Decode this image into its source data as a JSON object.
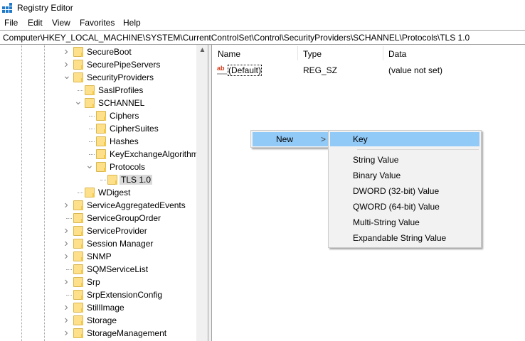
{
  "window": {
    "title": "Registry Editor"
  },
  "menubar": [
    "File",
    "Edit",
    "View",
    "Favorites",
    "Help"
  ],
  "address": "Computer\\HKEY_LOCAL_MACHINE\\SYSTEM\\CurrentControlSet\\Control\\SecurityProviders\\SCHANNEL\\Protocols\\TLS 1.0",
  "tree": [
    {
      "label": "SecureBoot",
      "level": 0,
      "exp": "collapsed"
    },
    {
      "label": "SecurePipeServers",
      "level": 0,
      "exp": "collapsed"
    },
    {
      "label": "SecurityProviders",
      "level": 0,
      "exp": "expanded"
    },
    {
      "label": "SaslProfiles",
      "level": 1,
      "exp": "none"
    },
    {
      "label": "SCHANNEL",
      "level": 1,
      "exp": "expanded"
    },
    {
      "label": "Ciphers",
      "level": 2,
      "exp": "none"
    },
    {
      "label": "CipherSuites",
      "level": 2,
      "exp": "none"
    },
    {
      "label": "Hashes",
      "level": 2,
      "exp": "none"
    },
    {
      "label": "KeyExchangeAlgorithms",
      "level": 2,
      "exp": "none"
    },
    {
      "label": "Protocols",
      "level": 2,
      "exp": "expanded"
    },
    {
      "label": "TLS 1.0",
      "level": 3,
      "exp": "none",
      "selected": true
    },
    {
      "label": "WDigest",
      "level": 1,
      "exp": "none"
    },
    {
      "label": "ServiceAggregatedEvents",
      "level": 0,
      "exp": "collapsed"
    },
    {
      "label": "ServiceGroupOrder",
      "level": 0,
      "exp": "none"
    },
    {
      "label": "ServiceProvider",
      "level": 0,
      "exp": "collapsed"
    },
    {
      "label": "Session Manager",
      "level": 0,
      "exp": "collapsed"
    },
    {
      "label": "SNMP",
      "level": 0,
      "exp": "collapsed"
    },
    {
      "label": "SQMServiceList",
      "level": 0,
      "exp": "none"
    },
    {
      "label": "Srp",
      "level": 0,
      "exp": "collapsed"
    },
    {
      "label": "SrpExtensionConfig",
      "level": 0,
      "exp": "none"
    },
    {
      "label": "StillImage",
      "level": 0,
      "exp": "collapsed"
    },
    {
      "label": "Storage",
      "level": 0,
      "exp": "collapsed"
    },
    {
      "label": "StorageManagement",
      "level": 0,
      "exp": "collapsed"
    }
  ],
  "list": {
    "columns": [
      "Name",
      "Type",
      "Data"
    ],
    "rows": [
      {
        "name": "(Default)",
        "type": "REG_SZ",
        "data": "(value not set)",
        "icon": "string-value-icon"
      }
    ]
  },
  "context_menu": {
    "item": "New",
    "arrow": ">"
  },
  "submenu": {
    "items": [
      "Key",
      "String Value",
      "Binary Value",
      "DWORD (32-bit) Value",
      "QWORD (64-bit) Value",
      "Multi-String Value",
      "Expandable String Value"
    ],
    "highlighted": "Key"
  },
  "colors": {
    "highlight": "#91c9f7",
    "folder": "#ffe08a",
    "selected_bg": "#d9d9d9"
  }
}
